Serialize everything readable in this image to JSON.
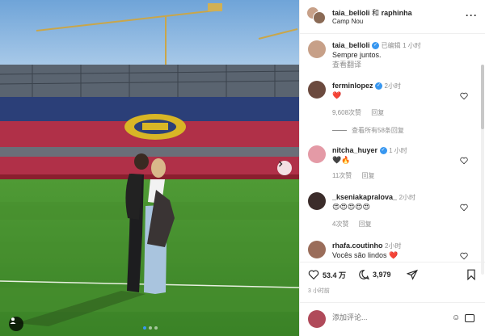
{
  "post": {
    "author": "taia_belloli",
    "collab_joiner": "和",
    "collaborator": "raphinha",
    "location": "Camp Nou",
    "caption_author": "taia_belloli",
    "edited_label": "已编辑",
    "caption_time": "1 小时",
    "caption_text": "Sempre juntos.",
    "translate_label": "查看翻译"
  },
  "comments": [
    {
      "user": "ferminlopez",
      "time": "2小时",
      "text": "❤️",
      "likes": "9,608次赞",
      "reply_label": "回复",
      "view_replies": "查看所有58条回复"
    },
    {
      "user": "nitcha_huyer",
      "time": "1 小时",
      "text": "🖤🔥",
      "likes": "11次赞",
      "reply_label": "回复"
    },
    {
      "user": "_kseniakapralova_",
      "time": "2小时",
      "text": "😍😍😍😍😍",
      "likes": "4次赞",
      "reply_label": "回复"
    },
    {
      "user": "rhafa.coutinho",
      "time": "2小时",
      "text": "Vocês são lindos ❤️"
    }
  ],
  "actions": {
    "likes_count": "53.4 万",
    "comments_count": "3,979",
    "posted_ago": "3 小时前"
  },
  "composer": {
    "placeholder": "添加评论..."
  },
  "colors": {
    "verified": "#3897f0",
    "heart_red": "#ed4956",
    "grass": "#3f8f2a",
    "seats_red": "#b03048",
    "seats_blue": "#2b3f78",
    "crest_yellow": "#d8b626"
  },
  "icons": [
    "verified-icon",
    "more-icon",
    "heart-icon",
    "comment-icon",
    "share-icon",
    "bookmark-icon",
    "next-arrow-icon",
    "user-tag-icon",
    "emoji-icon",
    "gif-icon"
  ]
}
